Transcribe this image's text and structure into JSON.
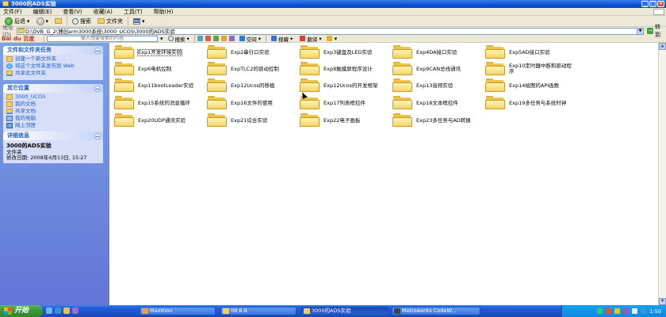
{
  "window": {
    "title": "3000的ADS实验"
  },
  "menu": [
    "文件(F)",
    "编辑(E)",
    "查看(V)",
    "收藏(A)",
    "工具(T)",
    "帮助(H)"
  ],
  "toolbar": {
    "back": "后退",
    "search": "搜索",
    "folders": "文件夹"
  },
  "address": {
    "label": "地址(D)",
    "path": "D:\\DVB_G_2\\博创arm3000系统\\3000_UCOS\\3000的ADS实验",
    "go": "转到"
  },
  "baidu": {
    "logo": "Bai du 百度",
    "search_placeholder": "输入想要搜索的内容",
    "buttons": [
      "搜索",
      "空间",
      "搜藏",
      "翻译"
    ]
  },
  "sidebar": {
    "file_tasks": {
      "title": "文件和文件夹任务",
      "items": [
        {
          "icon": "new-folder-icon",
          "label": "创建一个新文件夹"
        },
        {
          "icon": "publish-web-icon",
          "label": "将这个文件夹发布到 Web"
        },
        {
          "icon": "share-folder-icon",
          "label": "共享此文件夹"
        }
      ]
    },
    "other_places": {
      "title": "其它位置",
      "items": [
        {
          "icon": "folder-icon",
          "label": "3000_UCOS"
        },
        {
          "icon": "my-documents-icon",
          "label": "我的文档"
        },
        {
          "icon": "shared-docs-icon",
          "label": "共享文档"
        },
        {
          "icon": "my-computer-icon",
          "label": "我的电脑"
        },
        {
          "icon": "network-icon",
          "label": "网上邻居"
        }
      ]
    },
    "details": {
      "title": "详细信息",
      "name": "3000的ADS实验",
      "type": "文件夹",
      "modified": "修改日期: 2008年4月13日, 15:27"
    }
  },
  "folders": [
    "Exp1开发环境实验",
    "Exp2串行口实验",
    "Exp3键盘及LED实验",
    "Exp4DA接口实验",
    "Exp5AD接口实验",
    "Exp6电机控制",
    "ExpTLC2的驱动控制",
    "Exp8触摸屏程序设计",
    "Exp9CAN总线通讯",
    "Exp10定时器中断和驱动程序",
    "Exp11bootLoader实验",
    "Exp12Ucos的移植",
    "Exp12Ucos的开发框架",
    "Exp13音频实验",
    "Exp14绘图的API函数",
    "Exp15系统的消息循环",
    "Exp16文件的使用",
    "Exp17列表框控件",
    "Exp18文本框控件",
    "Exp19多任务与系统时钟",
    "Exp20UDP通讯实验",
    "Exp21综合实验",
    "Exp22电子画板",
    "Exp23多任务与AD转换"
  ],
  "taskbar": {
    "start": "开始",
    "tasks": [
      "Maxthon",
      "08.6.9",
      "3000的ADS实验",
      "Metrowerks CodeW..."
    ],
    "clock": "1:50"
  },
  "colors": {
    "title_blue": "#0a52d6",
    "sidebar_blue": "#6375d6",
    "folder_yellow": "#f5d46a",
    "taskbar_blue": "#245edb",
    "start_green": "#3b9a3b"
  }
}
